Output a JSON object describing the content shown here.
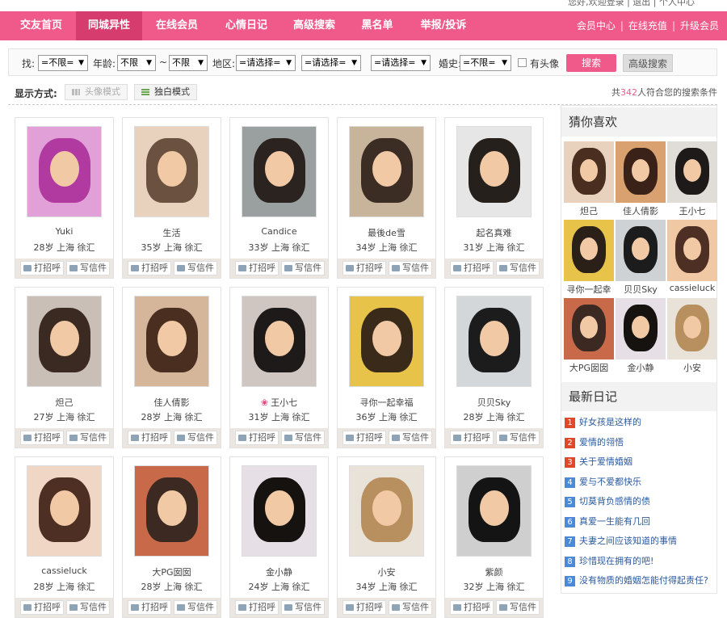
{
  "colors": {
    "accent": "#f05a8a",
    "accent_dark": "#d63d6e",
    "rank_red": "#e0482a",
    "rank_blue": "#4a8ad8"
  },
  "topstrip": {
    "text": "您好,欢迎登录 | 退出 | 个人中心"
  },
  "nav": {
    "items": [
      "交友首页",
      "同城异性",
      "在线会员",
      "心情日记",
      "高级搜索",
      "黑名单",
      "举报/投诉"
    ],
    "active_index": 1,
    "right": [
      "会员中心",
      "在线充值",
      "升级会员"
    ]
  },
  "search": {
    "gender_label": "找:",
    "gender_value": "=不限=",
    "age_label": "年龄:",
    "age_from": "不限",
    "age_to": "不限",
    "age_sep": "~",
    "region_label": "地区:",
    "region_values": [
      "=请选择=",
      "=请选择=",
      "=请选择="
    ],
    "marriage_label": "婚史:",
    "marriage_value": "=不限=",
    "avatar_label": "有头像",
    "search_button": "搜索",
    "advanced_button": "高级搜索"
  },
  "display": {
    "label": "显示方式:",
    "avatar_mode": "头像模式",
    "monologue_mode": "独白模式",
    "result_prefix": "共",
    "result_count": "342",
    "result_suffix": "人符合您的搜索条件"
  },
  "actions": {
    "greet": "打招呼",
    "mail": "写信件"
  },
  "cards": [
    {
      "name": "Yuki",
      "info": "28岁 上海 徐汇"
    },
    {
      "name": "生活",
      "info": "35岁 上海 徐汇"
    },
    {
      "name": "Candice",
      "info": "33岁 上海 徐汇"
    },
    {
      "name": "最後de雪",
      "info": "34岁 上海 徐汇"
    },
    {
      "name": "起名真难",
      "info": "31岁 上海 徐汇"
    },
    {
      "name": "炟己",
      "info": "27岁 上海 徐汇"
    },
    {
      "name": "佳人倩影",
      "info": "28岁 上海 徐汇"
    },
    {
      "name": "王小七",
      "info": "31岁 上海 徐汇",
      "vip": true
    },
    {
      "name": "寻你一起幸福",
      "info": "36岁 上海 徐汇"
    },
    {
      "name": "贝贝Sky",
      "info": "28岁 上海 徐汇"
    },
    {
      "name": "cassieluck",
      "info": "28岁 上海 徐汇"
    },
    {
      "name": "大PG囡囡",
      "info": "28岁 上海 徐汇"
    },
    {
      "name": "金小静",
      "info": "24岁 上海 徐汇"
    },
    {
      "name": "小安",
      "info": "34岁 上海 徐汇"
    },
    {
      "name": "紫颜",
      "info": "32岁 上海 徐汇"
    }
  ],
  "sidebar": {
    "guess_title": "猜你喜欢",
    "guess": [
      "炟己",
      "佳人倩影",
      "王小七",
      "寻你一起幸",
      "贝贝Sky",
      "cassieluck",
      "大PG囡囡",
      "金小静",
      "小安"
    ],
    "diary_title": "最新日记",
    "diary": [
      "好女孩是这样的",
      "爱情的翎悟",
      "关于爱情婚姻",
      "爱与不爱都快乐",
      "切莫背负感情的债",
      "真爱一生能有几回",
      "夫妻之间应该知道的事情",
      "珍惜现在拥有的吧!",
      "没有物质的婚姻怎能付得起责任?"
    ]
  }
}
